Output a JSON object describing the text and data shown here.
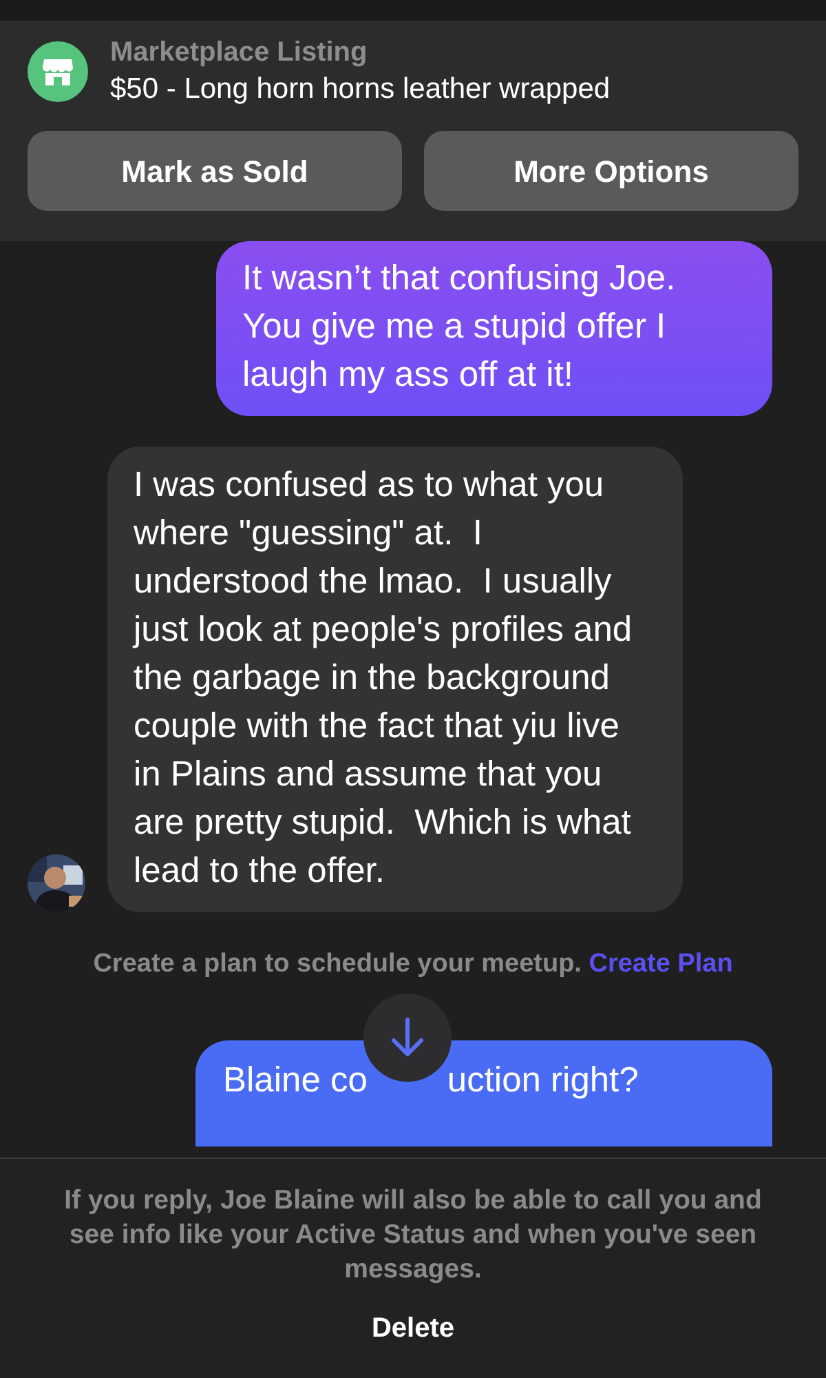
{
  "listing": {
    "label": "Marketplace Listing",
    "title": "$50 - Long horn horns leather wrapped"
  },
  "actions": [
    "Mark as Sold",
    "More Options"
  ],
  "messages": [
    {
      "kind": "sent",
      "text": "It wasn’t that confusing Joe. You give me a stupid offer I laugh my ass off at it!"
    },
    {
      "kind": "received",
      "text": "I was confused as to what you where \"guessing\" at.  I understood the lmao.  I usually just look at people's profiles and the garbage in the background couple with the fact that yiu live in Plains and assume that you are pretty stupid.  Which is what lead to the offer."
    }
  ],
  "plan": {
    "text": "Create a plan to schedule your meetup.",
    "link": "Create Plan"
  },
  "partial_message": {
    "kind": "sent",
    "parts": [
      "Blaine co",
      "uction right?"
    ]
  },
  "footer": {
    "notice": "If you reply, Joe Blaine will also be able to call you and see info like your Active Status and when you've seen messages.",
    "button": "Delete"
  }
}
